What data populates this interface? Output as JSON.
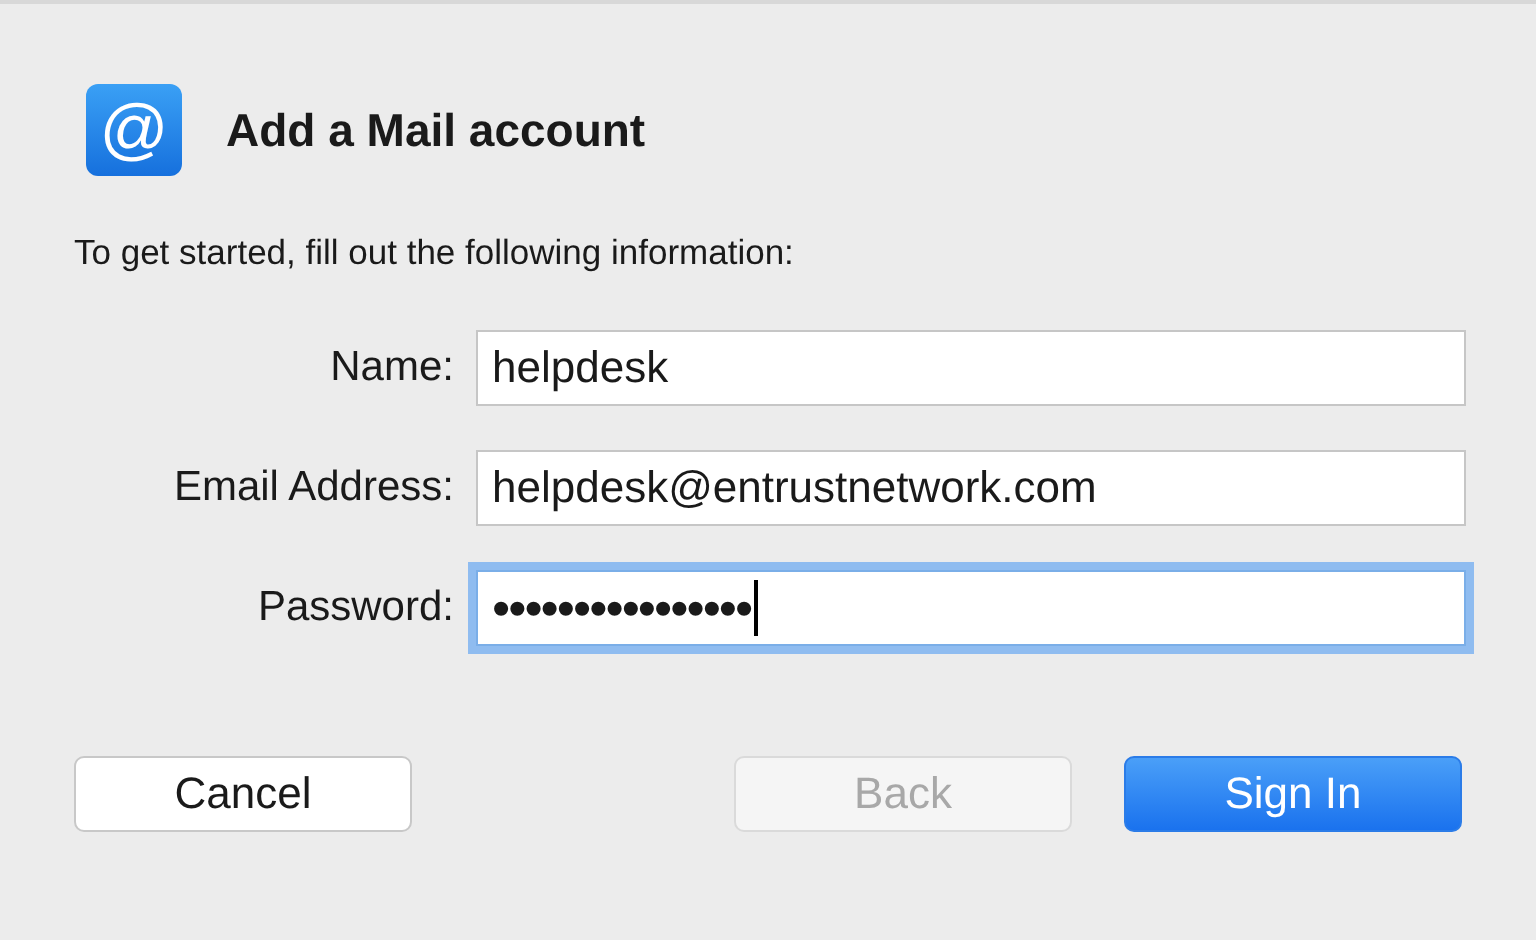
{
  "header": {
    "icon_glyph": "@",
    "title": "Add a Mail account"
  },
  "instructions": "To get started, fill out the following information:",
  "fields": [
    {
      "label": "Name:",
      "value": "helpdesk",
      "focused": false
    },
    {
      "label": "Email Address:",
      "value": "helpdesk@entrustnetwork.com",
      "focused": false
    },
    {
      "label": "Password:",
      "value": "••••••••••••••••",
      "focused": true
    }
  ],
  "buttons": [
    {
      "label": "Cancel",
      "kind": "normal",
      "disabled": false
    },
    {
      "label": "Back",
      "kind": "normal",
      "disabled": true
    },
    {
      "label": "Sign In",
      "kind": "default",
      "disabled": false
    }
  ]
}
